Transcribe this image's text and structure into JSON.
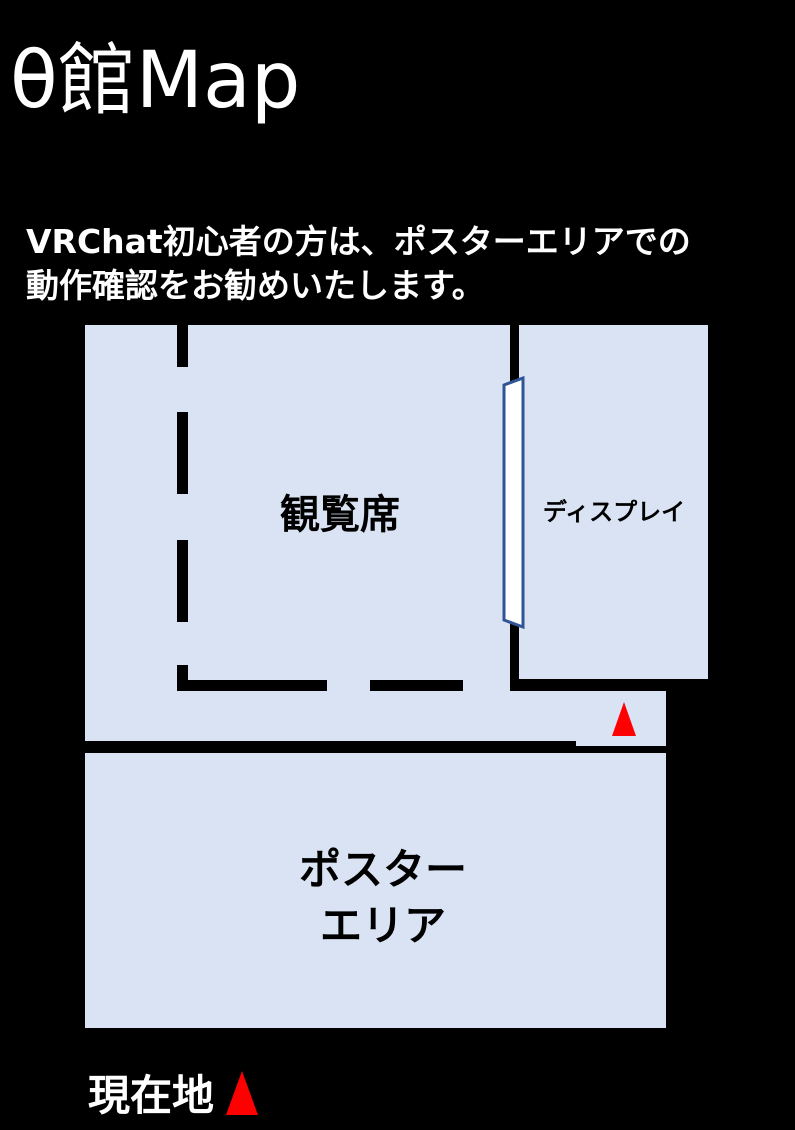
{
  "title": "θ館Map",
  "notice": {
    "line1": "VRChat初心者の方は、ポスターエリアでの",
    "line2": "動作確認をお勧めいたします。"
  },
  "areas": {
    "seats": "観覧席",
    "display": "ディスプレイ",
    "poster_line1": "ポスター",
    "poster_line2": "エリア"
  },
  "legend": {
    "label": "現在地",
    "marker_icon": "red-triangle-icon"
  },
  "colors": {
    "background": "#000000",
    "floor": "#dae3f3",
    "wall": "#000000",
    "marker": "#ff0000",
    "screen_border": "#2f5597"
  }
}
